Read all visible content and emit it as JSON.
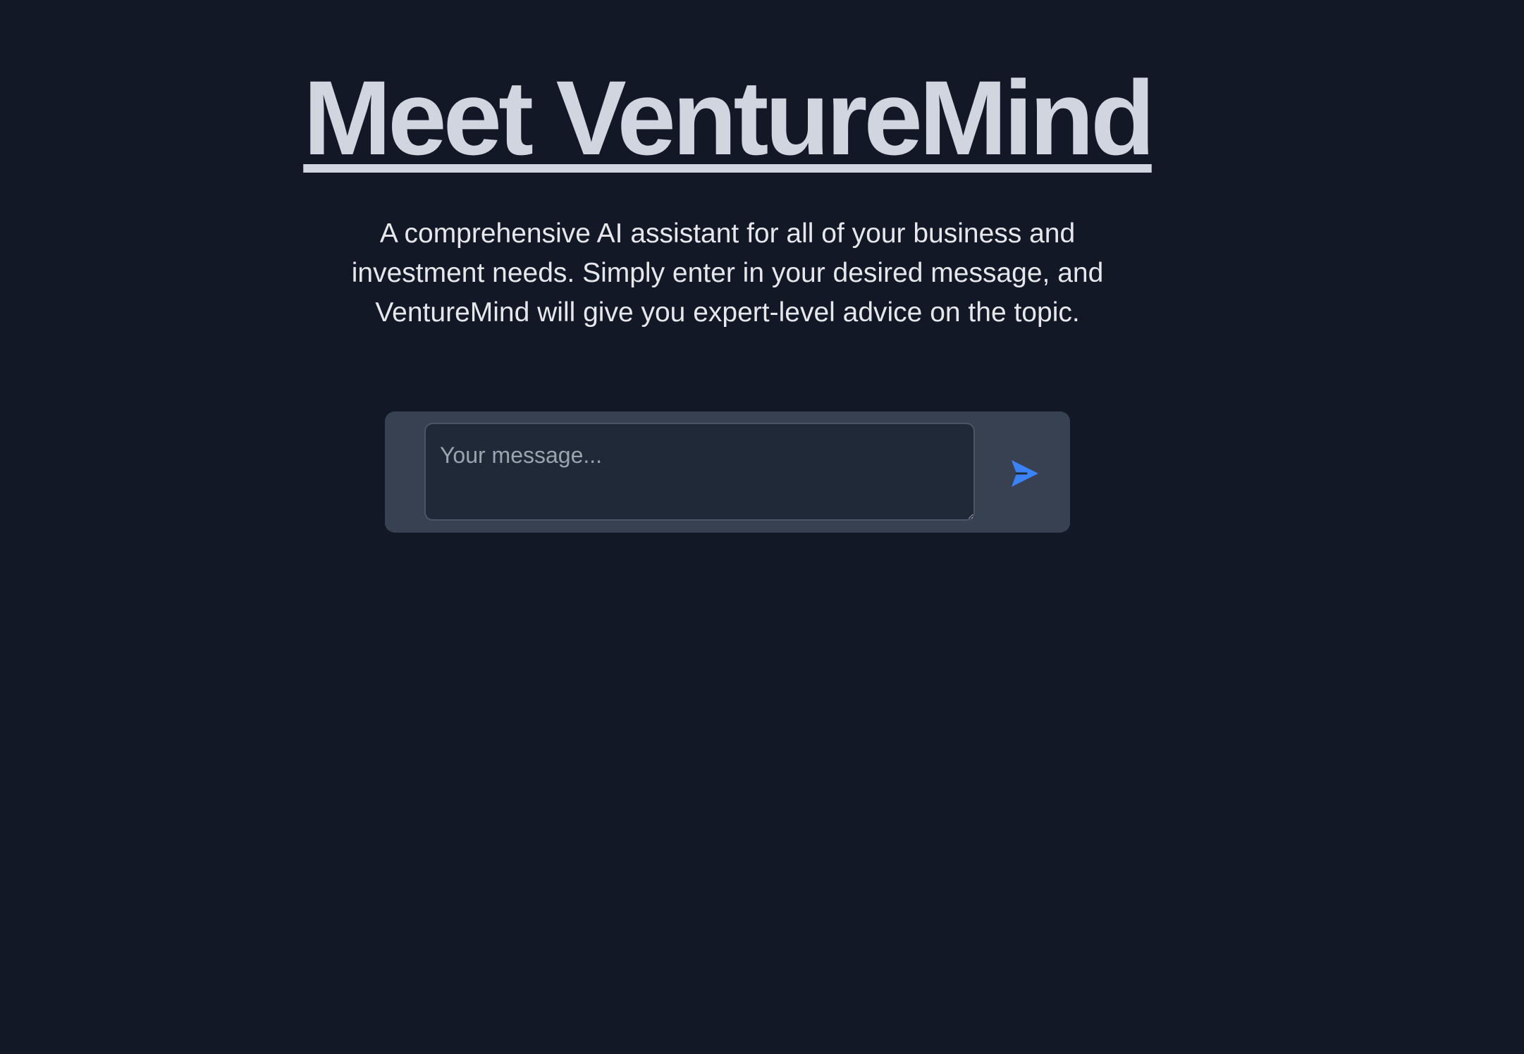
{
  "hero": {
    "title": "Meet VentureMind",
    "description": "A comprehensive AI assistant for all of your business and investment needs. Simply enter in your desired message, and VentureMind will give you expert-level advice on the topic."
  },
  "composer": {
    "input_value": "",
    "input_placeholder": "Your message...",
    "send_icon": "send-paper-plane-icon"
  },
  "colors": {
    "background": "#121826",
    "title": "#d1d5e0",
    "text": "#e5e7eb",
    "composer_panel": "#374151",
    "input_background": "#1f2937",
    "accent": "#3b82f6"
  }
}
